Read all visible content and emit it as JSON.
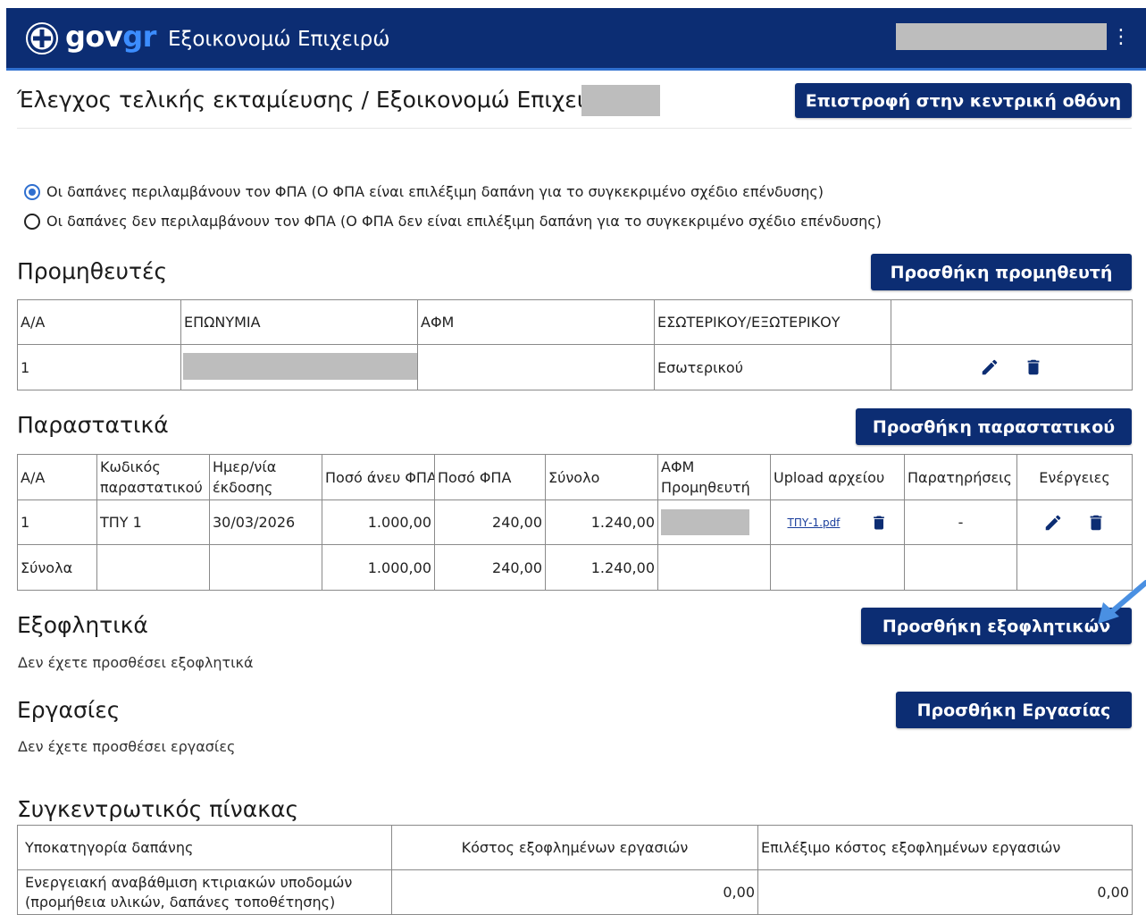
{
  "header": {
    "brand_gov": "gov",
    "brand_gr": "gr",
    "app_title": "Εξοικονομώ Επιχειρώ",
    "menu_icon": "kebab-menu-icon",
    "emblem_icon": "greek-emblem-icon"
  },
  "page": {
    "breadcrumb": "Έλεγχος τελικής εκταμίευσης / Εξοικονομώ Επιχειρώ /",
    "back_button": "Επιστροφή στην κεντρική οθόνη"
  },
  "vat": {
    "option_included": "Οι δαπάνες περιλαμβάνουν τον ΦΠΑ (Ο ΦΠΑ είναι επιλέξιμη δαπάνη για το συγκεκριμένο σχέδιο επένδυσης)",
    "option_excluded": "Οι δαπάνες δεν περιλαμβάνουν τον ΦΠΑ (Ο ΦΠΑ δεν είναι επιλέξιμη δαπάνη για το συγκεκριμένο σχέδιο επένδυσης)",
    "selected": "included"
  },
  "suppliers": {
    "title": "Προμηθευτές",
    "add_button": "Προσθήκη προμηθευτή",
    "headers": [
      "Α/Α",
      "ΕΠΩΝΥΜΙΑ",
      "ΑΦΜ",
      "ΕΣΩΤΕΡΙΚΟΥ/ΕΞΩΤΕΡΙΚΟΥ",
      ""
    ],
    "rows": [
      {
        "aa": "1",
        "type": "Εσωτερικού"
      }
    ]
  },
  "documents": {
    "title": "Παραστατικά",
    "add_button": "Προσθήκη παραστατικού",
    "headers": {
      "aa": "Α/Α",
      "code_1": "Κωδικός",
      "code_2": "παραστατικού",
      "date_1": "Ημερ/νία",
      "date_2": "έκδοσης",
      "net": "Ποσό άνευ ΦΠΑ",
      "vat": "Ποσό ΦΠΑ",
      "total": "Σύνολο",
      "afm_1": "ΑΦΜ",
      "afm_2": "Προμηθευτή",
      "upload": "Upload αρχείου",
      "remarks": "Παρατηρήσεις",
      "actions": "Ενέργειες"
    },
    "rows": [
      {
        "aa": "1",
        "code": "ΤΠΥ 1",
        "date": "30/03/2026",
        "net": "1.000,00",
        "vat": "240,00",
        "total": "1.240,00",
        "file": "ΤΠΥ-1.pdf",
        "remarks": "-"
      }
    ],
    "totals": {
      "label": "Σύνολα",
      "net": "1.000,00",
      "vat": "240,00",
      "total": "1.240,00"
    }
  },
  "payments": {
    "title": "Εξοφλητικά",
    "add_button": "Προσθήκη εξοφλητικών",
    "empty": "Δεν έχετε προσθέσει εξοφλητικά"
  },
  "works": {
    "title": "Εργασίες",
    "add_button": "Προσθήκη Εργασίας",
    "empty": "Δεν έχετε προσθέσει εργασίες"
  },
  "summary": {
    "title": "Συγκεντρωτικός πίνακας",
    "headers": [
      "Υποκατηγορία δαπάνης",
      "Κόστος εξοφλημένων εργασιών",
      "Επιλέξιμο κόστος εξοφλημένων εργασιών"
    ],
    "rows": [
      {
        "category_1": "Ενεργειακή αναβάθμιση κτιριακών υποδομών",
        "category_2": "(προμήθεια υλικών, δαπάνες τοποθέτησης)",
        "cost": "0,00",
        "eligible": "0,00"
      }
    ]
  },
  "colors": {
    "navy": "#0c2d73",
    "accent": "#2f6fcf",
    "redacted": "#bdbdbd"
  }
}
